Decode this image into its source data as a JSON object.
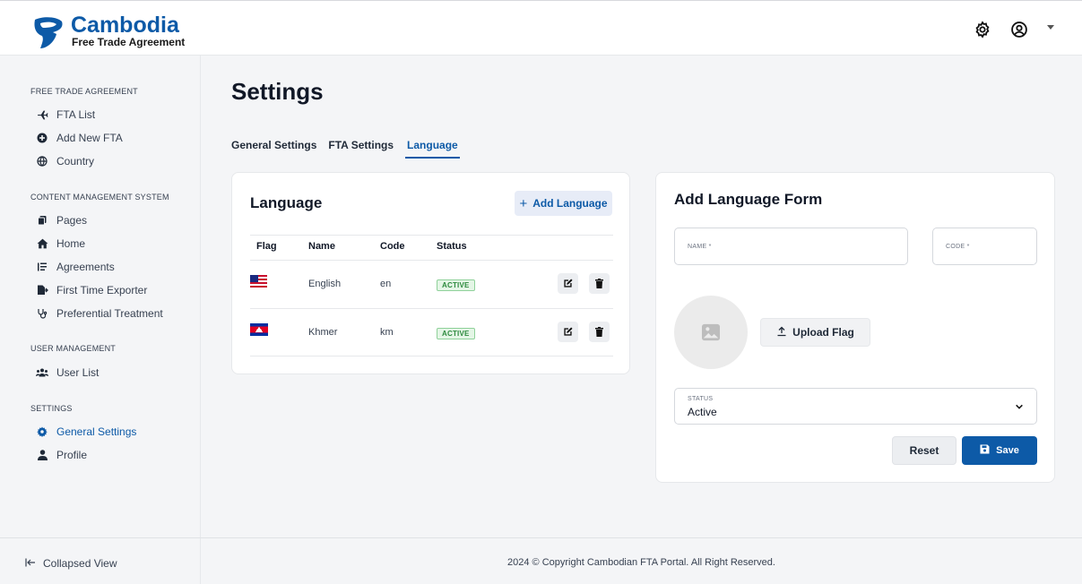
{
  "header": {
    "logo_title": "Cambodia",
    "logo_subtitle": "Free Trade Agreement",
    "icons": [
      "settings-icon",
      "user-circle-icon",
      "caret-down-icon"
    ]
  },
  "sidebar": {
    "sections": [
      {
        "title": "FREE TRADE AGREEMENT",
        "items": [
          {
            "label": "FTA List",
            "icon": "plane-icon"
          },
          {
            "label": "Add New FTA",
            "icon": "plus-circle-icon"
          },
          {
            "label": "Country",
            "icon": "globe-icon"
          }
        ]
      },
      {
        "title": "CONTENT MANAGEMENT SYSTEM",
        "items": [
          {
            "label": "Pages",
            "icon": "copy-icon"
          },
          {
            "label": "Home",
            "icon": "home-icon"
          },
          {
            "label": "Agreements",
            "icon": "list-icon"
          },
          {
            "label": "First Time Exporter",
            "icon": "file-export-icon"
          },
          {
            "label": "Preferential Treatment",
            "icon": "stethoscope-icon"
          }
        ]
      },
      {
        "title": "USER MANAGEMENT",
        "items": [
          {
            "label": "User List",
            "icon": "users-icon"
          }
        ]
      },
      {
        "title": "SETTINGS",
        "items": [
          {
            "label": "General Settings",
            "icon": "cog-icon",
            "active": true
          },
          {
            "label": "Profile",
            "icon": "user-icon"
          }
        ]
      }
    ],
    "collapse_label": "Collapsed View"
  },
  "page": {
    "title": "Settings",
    "tabs": [
      {
        "label": "General Settings"
      },
      {
        "label": "FTA Settings"
      },
      {
        "label": "Language",
        "active": true
      }
    ]
  },
  "language_card": {
    "title": "Language",
    "add_button": "Add Language",
    "columns": [
      "Flag",
      "Name",
      "Code",
      "Status"
    ],
    "rows": [
      {
        "flag": "us-flag",
        "name": "English",
        "code": "en",
        "status": "ACTIVE"
      },
      {
        "flag": "kh-flag",
        "name": "Khmer",
        "code": "km",
        "status": "ACTIVE"
      }
    ]
  },
  "form": {
    "title": "Add Language Form",
    "name_label": "NAME *",
    "code_label": "CODE *",
    "upload_label": "Upload Flag",
    "status_label": "STATUS",
    "status_value": "Active",
    "reset_label": "Reset",
    "save_label": "Save"
  },
  "footer": {
    "copyright": "2024 © Copyright Cambodian FTA Portal. All Right Reserved."
  },
  "colors": {
    "primary": "#0d5aa7",
    "active_badge": "#2d8a3e"
  }
}
